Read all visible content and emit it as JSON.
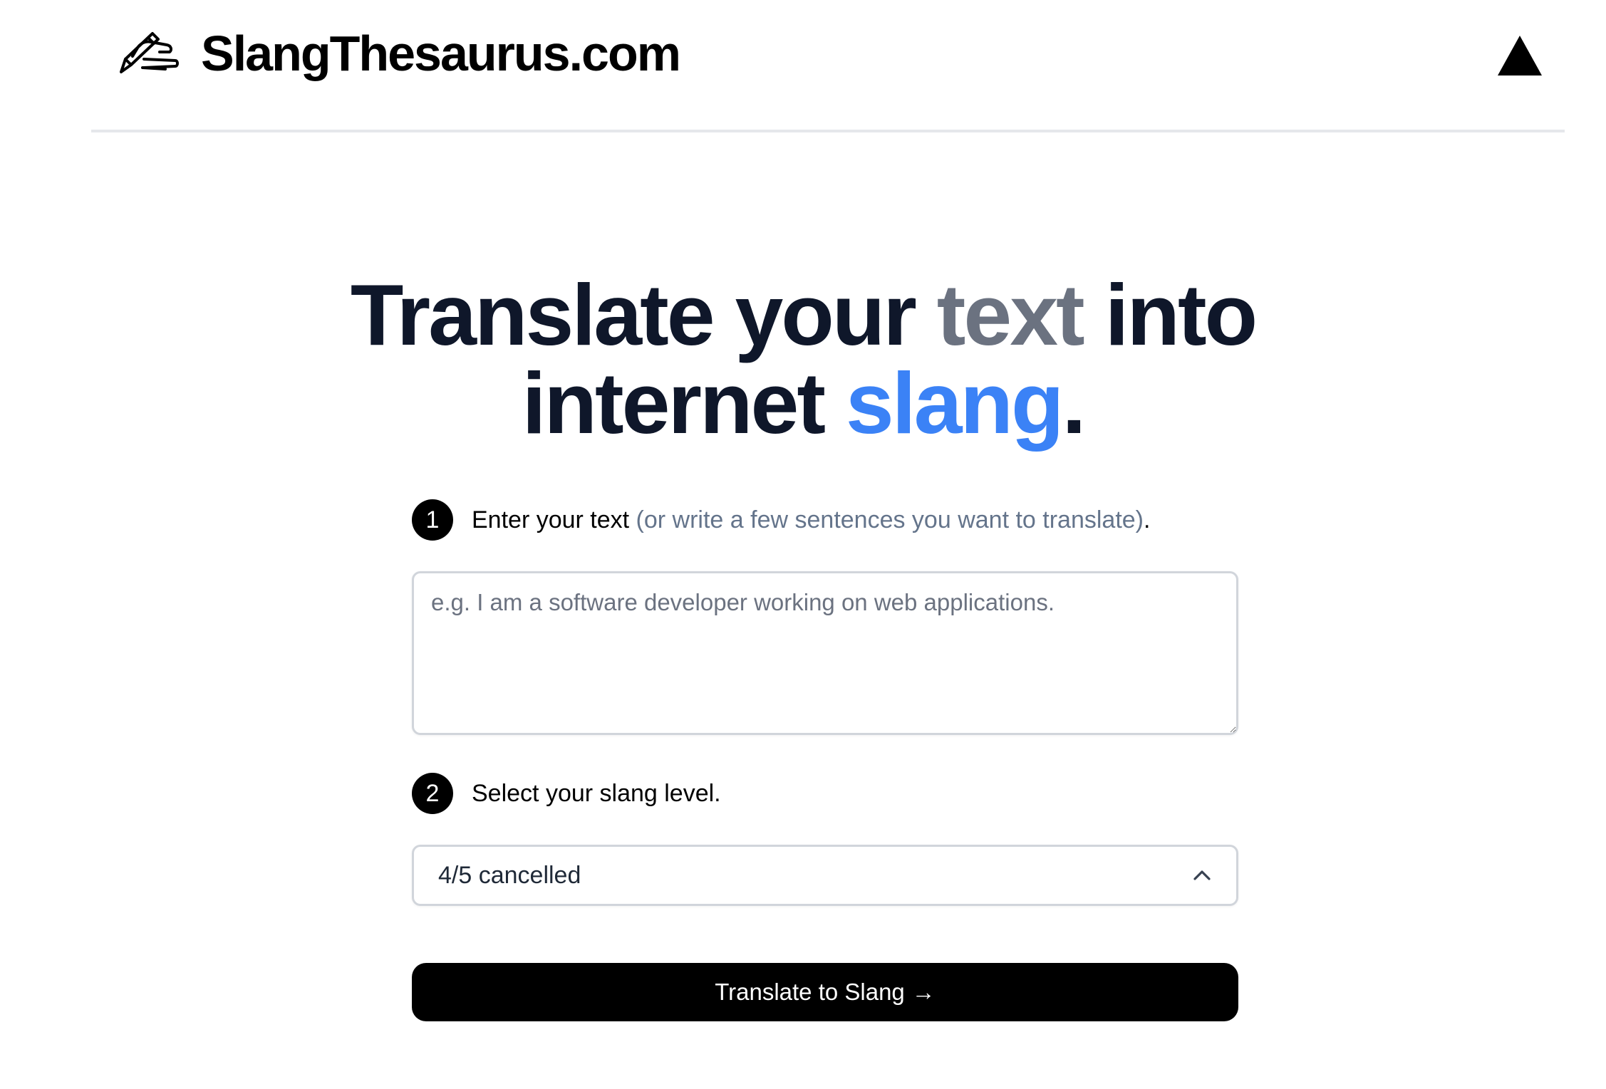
{
  "header": {
    "brand_icon": "writing-hand-icon",
    "title": "SlangThesaurus.com",
    "repo_icon": "triangle-logo-icon"
  },
  "hero": {
    "part1": "Translate your ",
    "highlight_text": "text",
    "part2": " into",
    "part3": "internet ",
    "highlight_slang": "slang",
    "period": "."
  },
  "step1": {
    "number": "1",
    "label": "Enter your text",
    "hint": " (or write a few sentences you want to translate)",
    "end": "."
  },
  "input": {
    "value": "",
    "placeholder": "e.g. I am a software developer working on web applications."
  },
  "step2": {
    "number": "2",
    "label": "Select your slang level."
  },
  "slang_level": {
    "selected": "4/5 cancelled",
    "icon": "chevron-up-icon"
  },
  "submit": {
    "label": "Translate to Slang",
    "arrow": "→"
  },
  "colors": {
    "muted_word": "#6b7280",
    "accent_word": "#3b82f6",
    "button_bg": "#000000"
  }
}
